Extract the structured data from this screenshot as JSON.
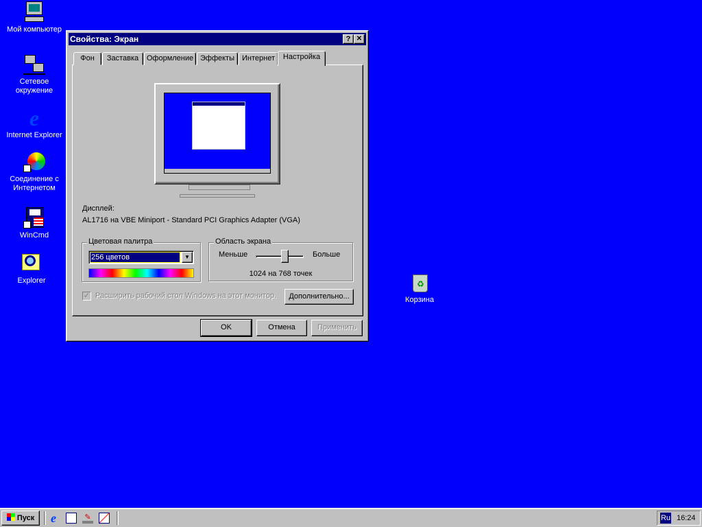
{
  "desktop": {
    "icons": [
      {
        "label": "Мой компьютер",
        "icon": "my-computer-icon"
      },
      {
        "label": "Сетевое окружение",
        "icon": "network-icon"
      },
      {
        "label": "Internet Explorer",
        "icon": "ie-icon"
      },
      {
        "label": "Соединение с Интернетом",
        "icon": "connection-wizard-icon"
      },
      {
        "label": "WinCmd",
        "icon": "wincmd-icon"
      },
      {
        "label": "Explorer",
        "icon": "explorer-icon"
      },
      {
        "label": "Корзина",
        "icon": "recycle-bin-icon"
      }
    ]
  },
  "dialog": {
    "title": "Свойства: Экран",
    "help": "?",
    "close": "✕",
    "tabs": [
      "Фон",
      "Заставка",
      "Оформление",
      "Эффекты",
      "Интернет",
      "Настройка"
    ],
    "active_tab": "Настройка",
    "display_label": "Дисплей:",
    "display_value": "AL1716 на VBE Miniport - Standard PCI Graphics Adapter (VGA)",
    "palette": {
      "legend": "Цветовая палитра",
      "selected": "256 цветов"
    },
    "area": {
      "legend": "Область экрана",
      "less": "Меньше",
      "more": "Больше",
      "value": "1024 на 768 точек",
      "slider_fraction": 0.6
    },
    "extend_checkbox": {
      "label": "Расширить рабочий стол Windows на этот монитор.",
      "checked": true,
      "disabled": true
    },
    "advanced": "Дополнительно...",
    "ok": "OK",
    "cancel": "Отмена",
    "apply": "Применить"
  },
  "taskbar": {
    "start": "Пуск",
    "quick_launch": [
      "ie-icon",
      "outlook-express-icon",
      "desktop-icon",
      "channels-icon"
    ],
    "lang": "Ru",
    "clock": "16:24"
  },
  "colors": {
    "desktop": "#0000fc",
    "title": "#000080",
    "face": "#c0c0c0"
  }
}
